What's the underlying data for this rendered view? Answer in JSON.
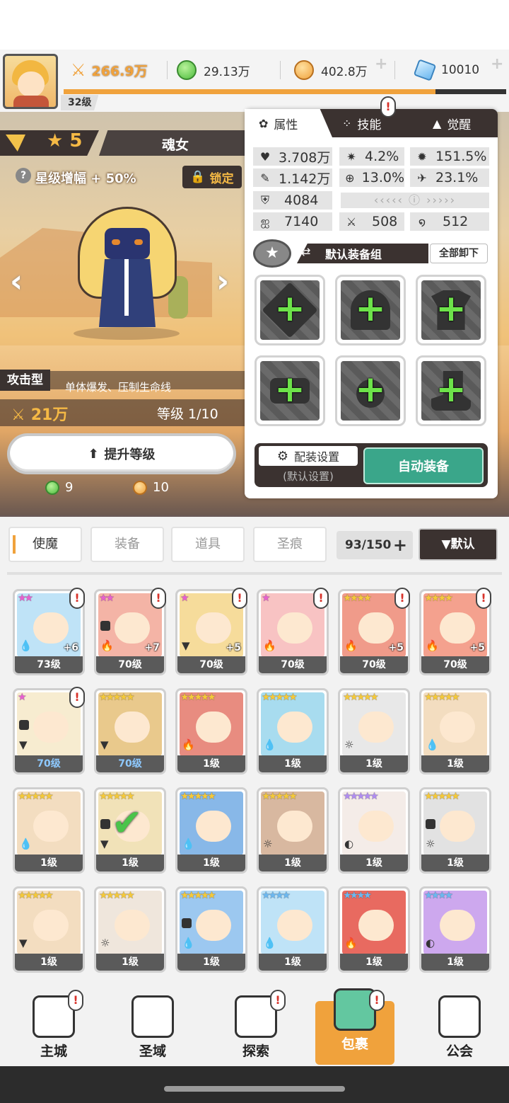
{
  "player": {
    "level": "32级",
    "power": "266.9万",
    "xp_progress": 0.84
  },
  "resources": [
    {
      "name": "green-coin",
      "value": "29.13万",
      "icon": "green-coin-icon"
    },
    {
      "name": "gold-coin",
      "value": "402.8万",
      "icon": "gold-coin-icon"
    },
    {
      "name": "gem",
      "value": "10010",
      "icon": "diamond-icon"
    }
  ],
  "hero": {
    "stars": "5",
    "name": "魂女",
    "star_boost": "星级增幅 + 50%",
    "lock": "锁定",
    "class": "攻击型",
    "class_desc": "单体爆发、压制生命线",
    "power": "21万",
    "level": "等级 1/10",
    "upgrade": "提升等级",
    "cost_green": "9",
    "cost_gold": "10"
  },
  "panel": {
    "tabs": [
      "属性",
      "技能",
      "觉醒"
    ],
    "stats": {
      "hp": "3.708万",
      "crit": "4.2%",
      "crit_dmg": "151.5%",
      "atk": "1.142万",
      "accuracy": "13.0%",
      "speed": "23.1%",
      "def": "4084",
      "s1": "7140",
      "s2": "508",
      "s3": "512"
    },
    "set_name": "默认装备组",
    "unequip_all": "全部卸下",
    "config": "配装设置",
    "config_sub": "(默认设置)",
    "auto_equip": "自动装备"
  },
  "bag": {
    "tabs": [
      "使魔",
      "装备",
      "道具",
      "圣痕"
    ],
    "capacity": "93/150",
    "sort": "▼默认",
    "cards": [
      {
        "level": "73级",
        "stars": "★★",
        "star_color": "#e85fcf",
        "plus": "+6",
        "bg": "#bfe3f7",
        "elem": "💧",
        "alert": true,
        "lock": false,
        "check": false,
        "blue": false
      },
      {
        "level": "70级",
        "stars": "★★",
        "star_color": "#e85fcf",
        "plus": "+7",
        "bg": "#f4b4a6",
        "elem": "🔥",
        "alert": true,
        "lock": true,
        "check": false,
        "blue": false
      },
      {
        "level": "70级",
        "stars": "★",
        "star_color": "#e85fcf",
        "plus": "+5",
        "bg": "#f6dc9b",
        "elem": "▼",
        "alert": true,
        "lock": false,
        "check": false,
        "blue": false
      },
      {
        "level": "70级",
        "stars": "★",
        "star_color": "#e85fcf",
        "plus": "",
        "bg": "#f8c3c3",
        "elem": "🔥",
        "alert": true,
        "lock": false,
        "check": false,
        "blue": false
      },
      {
        "level": "70级",
        "stars": "★★★★",
        "star_color": "#f5c93a",
        "plus": "+5",
        "bg": "#f09b8a",
        "elem": "🔥",
        "alert": true,
        "lock": false,
        "check": false,
        "blue": false
      },
      {
        "level": "70级",
        "stars": "★★★★",
        "star_color": "#f5c93a",
        "plus": "+5",
        "bg": "#f4a18e",
        "elem": "🔥",
        "alert": true,
        "lock": false,
        "check": false,
        "blue": false
      },
      {
        "level": "70级",
        "stars": "★",
        "star_color": "#e85fcf",
        "plus": "",
        "bg": "#f7ecd0",
        "elem": "▼",
        "alert": true,
        "lock": true,
        "check": false,
        "blue": true
      },
      {
        "level": "70级",
        "stars": "★★★★★",
        "star_color": "#f5c93a",
        "plus": "",
        "bg": "#e9c98c",
        "elem": "▼",
        "alert": false,
        "lock": false,
        "check": false,
        "blue": true
      },
      {
        "level": "1级",
        "stars": "★★★★★",
        "star_color": "#f5c93a",
        "plus": "",
        "bg": "#e88c80",
        "elem": "🔥",
        "alert": false,
        "lock": false,
        "check": false,
        "blue": false
      },
      {
        "level": "1级",
        "stars": "★★★★★",
        "star_color": "#f5c93a",
        "plus": "",
        "bg": "#a8dcef",
        "elem": "💧",
        "alert": false,
        "lock": false,
        "check": false,
        "blue": false
      },
      {
        "level": "1级",
        "stars": "★★★★★",
        "star_color": "#f5c93a",
        "plus": "",
        "bg": "#e8e8e8",
        "elem": "☼",
        "alert": false,
        "lock": false,
        "check": false,
        "blue": false
      },
      {
        "level": "1级",
        "stars": "★★★★★",
        "star_color": "#f5c93a",
        "plus": "",
        "bg": "#f3ddc0",
        "elem": "💧",
        "alert": false,
        "lock": false,
        "check": false,
        "blue": false
      },
      {
        "level": "1级",
        "stars": "★★★★★",
        "star_color": "#f5c93a",
        "plus": "",
        "bg": "#f3ddc0",
        "elem": "💧",
        "alert": false,
        "lock": false,
        "check": false,
        "blue": false
      },
      {
        "level": "1级",
        "stars": "★★★★★",
        "star_color": "#f5c93a",
        "plus": "",
        "bg": "#f1e2b8",
        "elem": "▼",
        "alert": false,
        "lock": true,
        "check": true,
        "blue": false
      },
      {
        "level": "1级",
        "stars": "★★★★★",
        "star_color": "#f5c93a",
        "plus": "",
        "bg": "#88b8e8",
        "elem": "💧",
        "alert": false,
        "lock": false,
        "check": false,
        "blue": false
      },
      {
        "level": "1级",
        "stars": "★★★★★",
        "star_color": "#f5c93a",
        "plus": "",
        "bg": "#d8b8a0",
        "elem": "☼",
        "alert": false,
        "lock": false,
        "check": false,
        "blue": false
      },
      {
        "level": "1级",
        "stars": "★★★★★",
        "star_color": "#b08cf0",
        "plus": "",
        "bg": "#f4ece8",
        "elem": "◐",
        "alert": false,
        "lock": false,
        "check": false,
        "blue": false
      },
      {
        "level": "1级",
        "stars": "★★★★★",
        "star_color": "#f5c93a",
        "plus": "",
        "bg": "#e2e2e2",
        "elem": "☼",
        "alert": false,
        "lock": true,
        "check": false,
        "blue": false
      },
      {
        "level": "1级",
        "stars": "★★★★★",
        "star_color": "#f5c93a",
        "plus": "",
        "bg": "#f3ddc0",
        "elem": "▼",
        "alert": false,
        "lock": false,
        "check": false,
        "blue": false
      },
      {
        "level": "1级",
        "stars": "★★★★★",
        "star_color": "#f5c93a",
        "plus": "",
        "bg": "#efe6dc",
        "elem": "☼",
        "alert": false,
        "lock": false,
        "check": false,
        "blue": false
      },
      {
        "level": "1级",
        "stars": "★★★★★",
        "star_color": "#f5c93a",
        "plus": "",
        "bg": "#9cc8f0",
        "elem": "💧",
        "alert": false,
        "lock": true,
        "check": false,
        "blue": false
      },
      {
        "level": "1级",
        "stars": "★★★★",
        "star_color": "#6cb8f0",
        "plus": "",
        "bg": "#bfe3f7",
        "elem": "💧",
        "alert": false,
        "lock": false,
        "check": false,
        "blue": false
      },
      {
        "level": "1级",
        "stars": "★★★★",
        "star_color": "#6cb8f0",
        "plus": "",
        "bg": "#e86a60",
        "elem": "🔥",
        "alert": false,
        "lock": false,
        "check": false,
        "blue": false
      },
      {
        "level": "1级",
        "stars": "★★★★",
        "star_color": "#6cb8f0",
        "plus": "",
        "bg": "#cda8ee",
        "elem": "◐",
        "alert": false,
        "lock": false,
        "check": false,
        "blue": false
      }
    ]
  },
  "nav": [
    {
      "label": "主城",
      "icon": "castle-icon",
      "alert": true,
      "active": false
    },
    {
      "label": "圣域",
      "icon": "vortex-icon",
      "alert": false,
      "active": false
    },
    {
      "label": "探索",
      "icon": "sword-icon",
      "alert": true,
      "active": false
    },
    {
      "label": "包裹",
      "icon": "backpack-icon",
      "alert": true,
      "active": true
    },
    {
      "label": "公会",
      "icon": "guild-icon",
      "alert": false,
      "active": false
    }
  ],
  "colors": {
    "accent": "#f0a23c",
    "dark": "#3b3230",
    "teal": "#3aa68a",
    "alert": "#d8322a"
  }
}
